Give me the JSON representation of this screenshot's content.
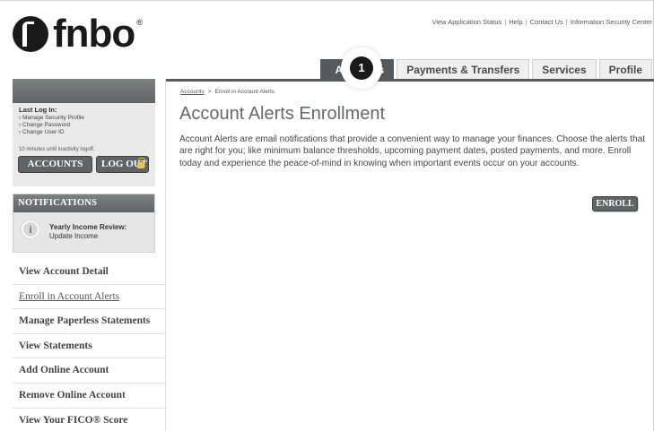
{
  "brand": {
    "logo_text": "fnbo",
    "registered_mark": "®"
  },
  "utility_links": [
    "View Application Status",
    "Help",
    "Contact Us",
    "Information Security Center"
  ],
  "utility_separator": "|",
  "tabs": [
    {
      "label": "Accounts",
      "active": true
    },
    {
      "label": "Payments & Transfers",
      "active": false
    },
    {
      "label": "Services",
      "active": false
    },
    {
      "label": "Profile",
      "active": false
    }
  ],
  "step_badge": "1",
  "sidebar": {
    "last_login_label": "Last Log In:",
    "login_links": [
      "Manage Security Profile",
      "Change Password",
      "Change User ID"
    ],
    "logoff_note": "10 minutes until inactivity logoff.",
    "accounts_button": "ACCOUNTS",
    "logout_button": "LOG OUT",
    "notifications": {
      "header": "NOTIFICATIONS",
      "item_title": "Yearly Income Review:",
      "item_sub": "Update Income"
    },
    "nav_items": [
      {
        "label": "View Account Detail",
        "current": false
      },
      {
        "label": "Enroll in Account Alerts",
        "current": true
      },
      {
        "label": "Manage Paperless Statements",
        "current": false
      },
      {
        "label": "View Statements",
        "current": false
      },
      {
        "label": "Add Online Account",
        "current": false
      },
      {
        "label": "Remove Online Account",
        "current": false
      },
      {
        "label": "View Your FICO® Score",
        "current": false
      }
    ]
  },
  "main": {
    "breadcrumb": {
      "root": "Accounts",
      "separator": ">",
      "current": "Enroll in Account Alerts"
    },
    "title": "Account Alerts Enrollment",
    "description": "Account Alerts are email notifications that provide a convenient way to manage your finances. Choose the alerts that are right for you; like minimum balance thresholds, upcoming payment dates, posted payments, and more. Enroll today and experience the peace-of-mind in knowing when important events occur on your accounts.",
    "enroll_button": "ENROLL"
  },
  "colors": {
    "tab_active_bg": "#555a5e",
    "title_color": "#5f6a72",
    "button_bg": "#5f6467"
  }
}
